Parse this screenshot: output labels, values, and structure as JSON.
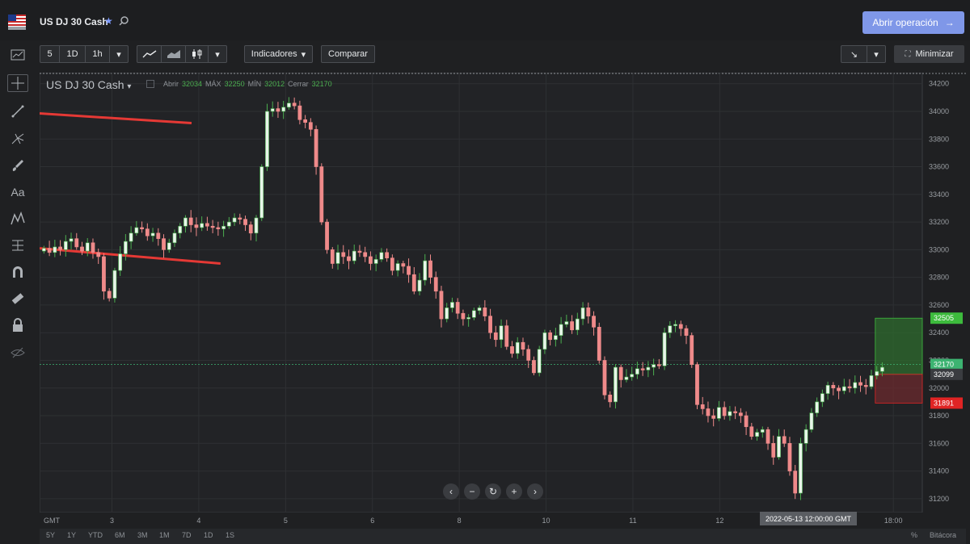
{
  "header": {
    "instrument": "US DJ 30 Cash",
    "open_trade_label": "Abrir operación"
  },
  "toolbar": {
    "periods": [
      "5",
      "1D",
      "1h"
    ],
    "indicators_label": "Indicadores",
    "compare_label": "Comparar",
    "minimize_label": "Minimizar"
  },
  "legend": {
    "title": "US DJ 30 Cash",
    "open_label": "Abrir",
    "open": "32034",
    "high_label": "MÁX",
    "high": "32250",
    "low_label": "MÍN",
    "low": "32012",
    "close_label": "Cerrar",
    "close": "32170"
  },
  "ranges": [
    "5Y",
    "1Y",
    "YTD",
    "6M",
    "3M",
    "1M",
    "7D",
    "1D",
    "1S"
  ],
  "bottom_right": {
    "percent": "%",
    "log": "Bitácora"
  },
  "crosshair_time": "2022-05-13 12:00:00 GMT",
  "colors": {
    "up": "#4caf50",
    "down": "#ef8a8a",
    "line": "#e53935",
    "take_profit": "#3dbb3d",
    "stop_loss": "#e02424",
    "current": "#3cb371",
    "accent": "#7f97e8"
  },
  "chart_data": {
    "type": "candlestick",
    "y_ticks": [
      34200,
      34000,
      33800,
      33600,
      33400,
      33200,
      33000,
      32800,
      32600,
      32400,
      32200,
      32000,
      31800,
      31600,
      31400,
      31200
    ],
    "ylim": [
      31100,
      34280
    ],
    "x_ticks": [
      {
        "label": "GMT",
        "x": 0
      },
      {
        "label": "3",
        "x": 20
      },
      {
        "label": "4",
        "x": 44
      },
      {
        "label": "5",
        "x": 68
      },
      {
        "label": "6",
        "x": 92
      },
      {
        "label": "8",
        "x": 116
      },
      {
        "label": "10",
        "x": 140
      },
      {
        "label": "11",
        "x": 164
      },
      {
        "label": "12",
        "x": 188
      },
      {
        "label": "18:00",
        "x": 236
      }
    ],
    "xlim": [
      0,
      244
    ],
    "price_labels": [
      {
        "value": 32505,
        "text": "32505",
        "kind": "take_profit"
      },
      {
        "value": 32170,
        "text": "32170",
        "kind": "current"
      },
      {
        "value": 32099,
        "text": "32099",
        "kind": "entry"
      },
      {
        "value": 31891,
        "text": "31891",
        "kind": "stop_loss"
      }
    ],
    "trend_lines": [
      {
        "x1": 0,
        "y1": 33985,
        "x2": 42,
        "y2": 33915
      },
      {
        "x1": 0,
        "y1": 33010,
        "x2": 50,
        "y2": 32900
      }
    ],
    "position_box": {
      "x1": 231,
      "x2": 245,
      "entry": 32099,
      "take_profit": 32505,
      "stop_loss": 31891
    },
    "current_price": 32170,
    "closes": [
      33010,
      32980,
      33020,
      33000,
      33060,
      33080,
      33020,
      32990,
      33050,
      32980,
      32950,
      32700,
      32650,
      32850,
      32970,
      33060,
      33120,
      33160,
      33150,
      33100,
      33120,
      33080,
      33000,
      33050,
      33120,
      33170,
      33230,
      33180,
      33160,
      33190,
      33170,
      33160,
      33150,
      33170,
      33200,
      33230,
      33220,
      33180,
      33120,
      33230,
      33600,
      34000,
      34020,
      34000,
      34030,
      34060,
      34040,
      33940,
      33920,
      33870,
      33600,
      33200,
      33000,
      32900,
      32980,
      32950,
      32920,
      32990,
      32980,
      32950,
      32900,
      32930,
      32980,
      32940,
      32850,
      32900,
      32880,
      32820,
      32700,
      32780,
      32920,
      32800,
      32700,
      32500,
      32580,
      32620,
      32540,
      32500,
      32510,
      32560,
      32580,
      32520,
      32400,
      32350,
      32450,
      32300,
      32250,
      32330,
      32280,
      32200,
      32110,
      32280,
      32400,
      32350,
      32380,
      32460,
      32480,
      32420,
      32500,
      32580,
      32520,
      32440,
      32200,
      31950,
      31900,
      32150,
      32060,
      32080,
      32100,
      32140,
      32130,
      32150,
      32170,
      32160,
      32400,
      32450,
      32460,
      32430,
      32380,
      32170,
      31880,
      31850,
      31800,
      31780,
      31860,
      31800,
      31830,
      31820,
      31800,
      31720,
      31650,
      31680,
      31700,
      31600,
      31500,
      31650,
      31600,
      31400,
      31240,
      31600,
      31700,
      31820,
      31900,
      31960,
      32020,
      32000,
      31980,
      32010,
      32000,
      32040,
      32020,
      32010,
      32090,
      32120,
      32150
    ]
  }
}
